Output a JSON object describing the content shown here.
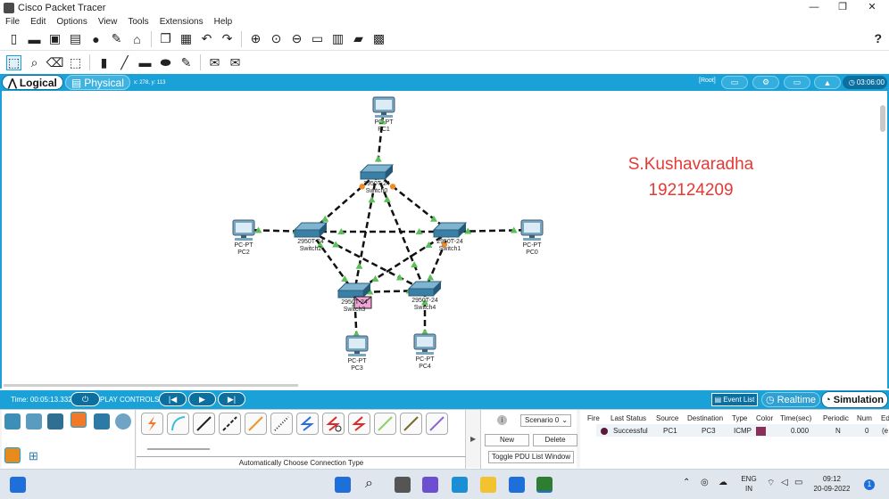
{
  "window": {
    "title": "Cisco Packet Tracer",
    "minimize": "—",
    "maximize": "❐",
    "close": "✕"
  },
  "menu": [
    "File",
    "Edit",
    "Options",
    "View",
    "Tools",
    "Extensions",
    "Help"
  ],
  "toolbar": {
    "help_label": "?"
  },
  "modebar": {
    "logical_label": "Logical",
    "physical_label": "Physical",
    "coords": "x: 278, y: 113",
    "root_label": "[Root]",
    "clock": "03:06:00"
  },
  "canvas": {
    "watermark_name": "S.Kushavaradha",
    "watermark_id": "192124209",
    "devices": [
      {
        "id": "pc1",
        "type": "PC-PT",
        "name": "PC1"
      },
      {
        "id": "sw0",
        "type": "2950T-24",
        "name": "Switch0"
      },
      {
        "id": "sw2",
        "type": "2950T-24",
        "name": "Switch2"
      },
      {
        "id": "sw1",
        "type": "2950T-24",
        "name": "Switch1"
      },
      {
        "id": "pc2",
        "type": "PC-PT",
        "name": "PC2"
      },
      {
        "id": "pc0",
        "type": "PC-PT",
        "name": "PC0"
      },
      {
        "id": "sw3",
        "type": "2950T-24",
        "name": "Switch3"
      },
      {
        "id": "sw4",
        "type": "2950T-24",
        "name": "Switch4"
      },
      {
        "id": "pc3",
        "type": "PC-PT",
        "name": "PC3"
      },
      {
        "id": "pc4",
        "type": "PC-PT",
        "name": "PC4"
      }
    ]
  },
  "simbar": {
    "time": "Time: 00:05:13.332",
    "play_controls": "PLAY CONTROLS",
    "event_list": "Event List",
    "realtime": "Realtime",
    "simulation": "Simulation"
  },
  "bottom": {
    "auto_conn": "Automatically Choose Connection Type",
    "scenario": "Scenario 0",
    "new_btn": "New",
    "delete_btn": "Delete",
    "toggle_btn": "Toggle PDU List Window",
    "pdu_headers": [
      "Fire",
      "Last Status",
      "Source",
      "Destination",
      "Type",
      "Color",
      "Time(sec)",
      "Periodic",
      "Num",
      "Ed"
    ],
    "pdu_row": {
      "status": "Successful",
      "source": "PC1",
      "dest": "PC3",
      "type": "ICMP",
      "color": "#8b2e5a",
      "time": "0.000",
      "periodic": "N",
      "num": "0",
      "ed": "(e"
    }
  },
  "taskbar": {
    "lang1": "ENG",
    "lang2": "IN",
    "time": "09:12",
    "date": "20-09-2022",
    "notif": "1"
  }
}
